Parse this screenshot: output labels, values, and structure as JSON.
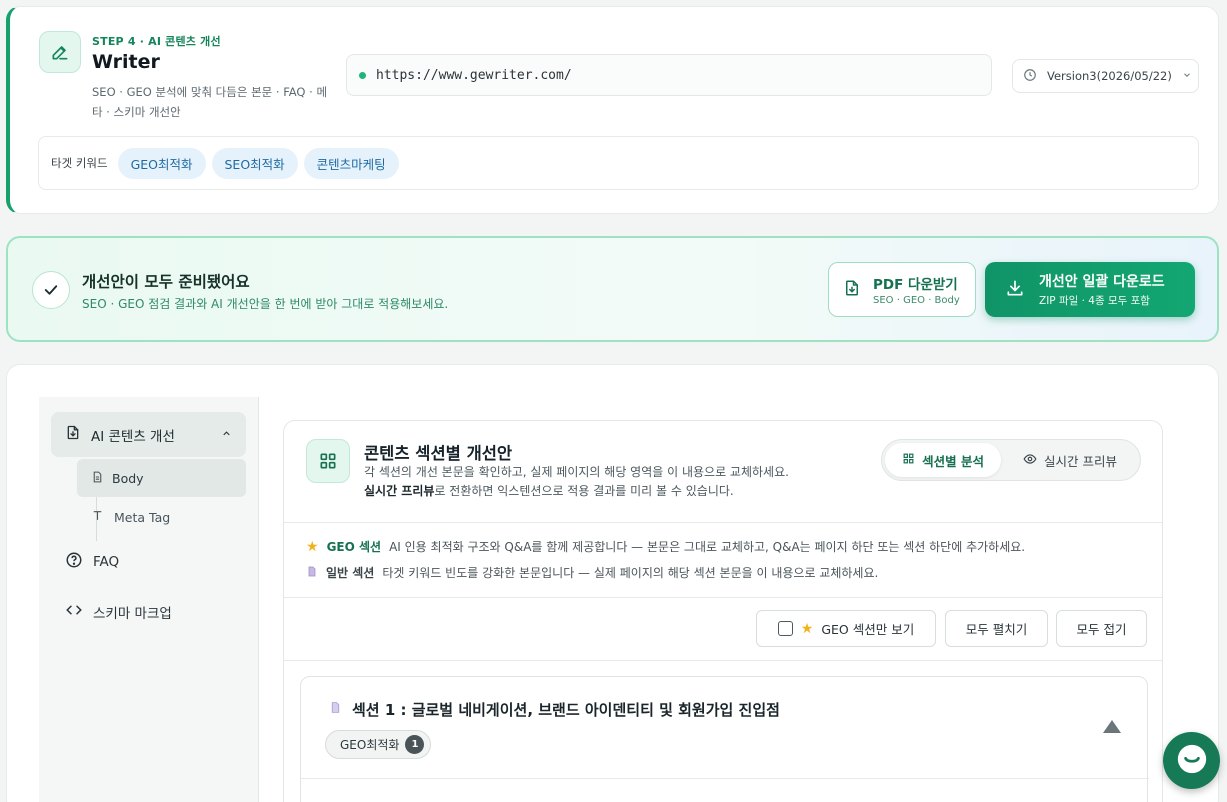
{
  "header": {
    "step_label": "STEP 4 · AI 콘텐츠 개선",
    "title": "Writer",
    "description": "SEO · GEO 분석에 맞춰 다듬은 본문 · FAQ · 메타 · 스키마 개선안",
    "url": "https://www.gewriter.com/",
    "version": "Version3(2026/05/22)",
    "keywords_label": "타겟 키워드",
    "keywords": [
      "GEO최적화",
      "SEO최적화",
      "콘텐츠마케팅"
    ]
  },
  "ready_banner": {
    "title": "개선안이 모두 준비됐어요",
    "subtitle": "SEO · GEO 점검 결과와 AI 개선안을 한 번에 받아 그대로 적용해보세요.",
    "pdf_button": {
      "label": "PDF 다운받기",
      "sub": "SEO · GEO · Body"
    },
    "download_button": {
      "label": "개선안 일괄 다운로드",
      "sub": "ZIP 파일 · 4종 모두 포함"
    }
  },
  "sidebar": {
    "top_item": "AI 콘텐츠 개선",
    "sub_items": [
      "Body",
      "Meta Tag"
    ],
    "items": [
      "FAQ",
      "스키마 마크업"
    ]
  },
  "panel": {
    "title": "콘텐츠 섹션별 개선안",
    "desc_line1": "각 섹션의 개선 본문을 확인하고, 실제 페이지의 해당 영역을 이 내용으로 교체하세요.",
    "desc_bold": "실시간 프리뷰",
    "desc_line2": "로 전환하면 익스텐션으로 적용 결과를 미리 볼 수 있습니다.",
    "toggle": [
      "섹션별 분석",
      "실시간 프리뷰"
    ],
    "legend_geo_key": "GEO 섹션",
    "legend_geo_text": "AI 인용 최적화 구조와 Q&A를 함께 제공합니다 — 본문은 그대로 교체하고, Q&A는 페이지 하단 또는 섹션 하단에 추가하세요.",
    "legend_normal_key": "일반 섹션",
    "legend_normal_text": "타겟 키워드 빈도를 강화한 본문입니다 — 실제 페이지의 해당 섹션 본문을 이 내용으로 교체하세요.",
    "controls": {
      "geo_only": "GEO 섹션만 보기",
      "expand_all": "모두 펼치기",
      "collapse_all": "모두 접기"
    },
    "section": {
      "title": "섹션 1 : 글로벌 네비게이션, 브랜드 아이덴티티 및 회원가입 진입점",
      "tag": "GEO최적화",
      "tag_count": "1"
    }
  },
  "colors": {
    "accent": "#15a06e",
    "accent_dark": "#109467",
    "chip_bg": "#e6f2fb"
  },
  "icons": [
    "pencil-icon",
    "clock-icon",
    "chevron-down-icon",
    "check-icon",
    "file-download-icon",
    "download-icon",
    "grid-icon",
    "eye-icon",
    "star-icon",
    "document-icon",
    "text-icon",
    "help-circle-icon",
    "code-icon",
    "chat-icon"
  ]
}
